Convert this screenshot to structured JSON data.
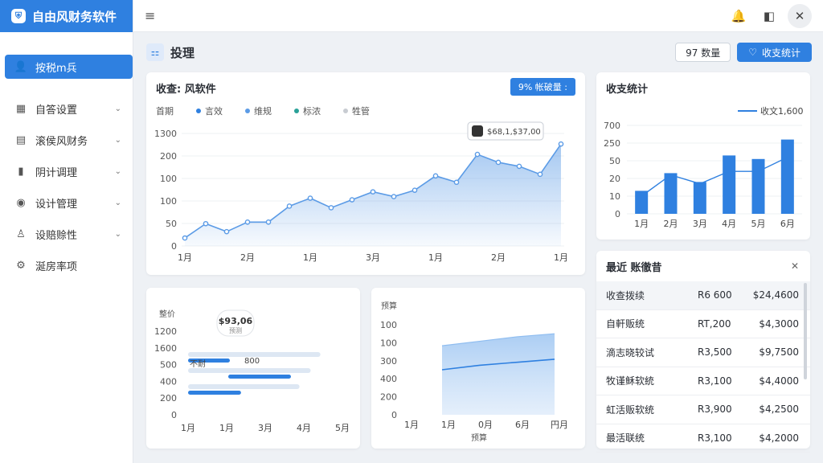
{
  "app": {
    "title": "自由风财务软件",
    "logo_glyph": "⛨"
  },
  "sidebar": {
    "items": [
      {
        "label": "按税m兵",
        "icon": "user-icon",
        "glyph": "👤",
        "active": true
      },
      {
        "label": "自答设置",
        "icon": "grid-icon",
        "glyph": "▦",
        "chevron": "⌄"
      },
      {
        "label": "滚侯风财务",
        "icon": "document-icon",
        "glyph": "▤",
        "chevron": "⌄"
      },
      {
        "label": "阴计调理",
        "icon": "bar-chart-icon",
        "glyph": "▮",
        "chevron": "⌄"
      },
      {
        "label": "设计管理",
        "icon": "switch-icon",
        "glyph": "◉",
        "chevron": "⌄"
      },
      {
        "label": "设赔赊性",
        "icon": "person-icon",
        "glyph": "♙",
        "chevron": "⌄"
      },
      {
        "label": "涎房率项",
        "icon": "gear-icon",
        "glyph": "⚙"
      }
    ]
  },
  "topbar": {
    "menu_glyph": "≡",
    "bell_glyph": "🔔",
    "profile_glyph": "◧",
    "close_glyph": "✕"
  },
  "page": {
    "title": "投理",
    "icon_glyph": "⚏",
    "btn_outline": "97 数量",
    "btn_primary": "收支统计",
    "btn_primary_icon": "♡"
  },
  "colors": {
    "accent": "#2f80e0",
    "accent_light": "#8fbdf0",
    "fill": "#cfe2f8"
  },
  "main_chart_card": {
    "title": "收查: 风软件",
    "button": "9% 帐破量 :",
    "legend": [
      {
        "label": "首期",
        "color": "none"
      },
      {
        "label": "言效",
        "color": "#2f80e0"
      },
      {
        "label": "维规",
        "color": "#5b9be6"
      },
      {
        "label": "标浓",
        "color": "#2aa198"
      },
      {
        "label": "牲管",
        "color": "#c8ccd2"
      }
    ],
    "tooltip": "$68,1,$37,00"
  },
  "bar_card": {
    "title": "收支统计",
    "legend": "收文1,600"
  },
  "recent_card": {
    "title": "最近  账徹昔",
    "close": "✕",
    "rows": [
      {
        "name": "收查拨续",
        "a": "R6 600",
        "b": "$24,4600"
      },
      {
        "name": "自軒贩统",
        "a": "RT,200",
        "b": "$4,3000"
      },
      {
        "name": "滴志晓较试",
        "a": "R3,500",
        "b": "$9,7500"
      },
      {
        "name": "牧谨稣软統",
        "a": "R3,100",
        "b": "$4,4000"
      },
      {
        "name": "虹活贩软统",
        "a": "R3,900",
        "b": "$4,2500"
      },
      {
        "name": "最活联统",
        "a": "R3,100",
        "b": "$4,2000"
      }
    ]
  },
  "hbar_card": {
    "ylabel": "整价",
    "badge_value": "$93,06",
    "badge_sub": "预测",
    "bar_label_1": "不耐",
    "bar_label_2": "800"
  },
  "area_card": {
    "ylabel": "预算",
    "xlabel": "预算"
  },
  "chart_data": [
    {
      "type": "line",
      "x": [
        "1月",
        "",
        "2月",
        "",
        "",
        "1月",
        "",
        "3月",
        "",
        "",
        "1月",
        "",
        "2月",
        "",
        "",
        "1月"
      ],
      "x_ticks": [
        "1月",
        "2月",
        "1月",
        "3月",
        "1月",
        "2月",
        "1月"
      ],
      "y_ticks": [
        "0",
        "50",
        "100",
        "100",
        "200",
        "1300"
      ],
      "values": [
        10,
        28,
        18,
        30,
        30,
        50,
        60,
        48,
        58,
        68,
        62,
        70,
        88,
        80,
        115,
        105,
        100,
        90,
        128
      ],
      "ylim": [
        0,
        130
      ]
    },
    {
      "type": "bar",
      "categories": [
        "1月",
        "2月",
        "3月",
        "4月",
        "5月",
        "6月"
      ],
      "values": [
        13,
        23,
        18,
        33,
        31,
        42
      ],
      "line_values": [
        10,
        22,
        17,
        24,
        24,
        32
      ],
      "y_ticks": [
        "0",
        "10",
        "20",
        "50",
        "250",
        "700"
      ],
      "ylim": [
        0,
        50
      ]
    },
    {
      "type": "bar",
      "orientation": "horizontal",
      "categories": [
        "1月",
        "1月",
        "3月",
        "4月",
        "5月"
      ],
      "y_ticks": [
        "0",
        "200",
        "400",
        "500",
        "1600",
        "1200"
      ],
      "series": [
        {
          "values": [
            300,
            450,
            380
          ]
        },
        {
          "values": [
            950,
            880,
            800
          ]
        }
      ]
    },
    {
      "type": "area",
      "categories": [
        "1月",
        "1月",
        "0月",
        "6月",
        "円月"
      ],
      "y_ticks": [
        "0",
        "200",
        "400",
        "300",
        "100",
        "100"
      ],
      "upper": [
        230,
        245,
        260,
        270
      ],
      "lower": [
        150,
        165,
        175,
        185
      ]
    }
  ]
}
